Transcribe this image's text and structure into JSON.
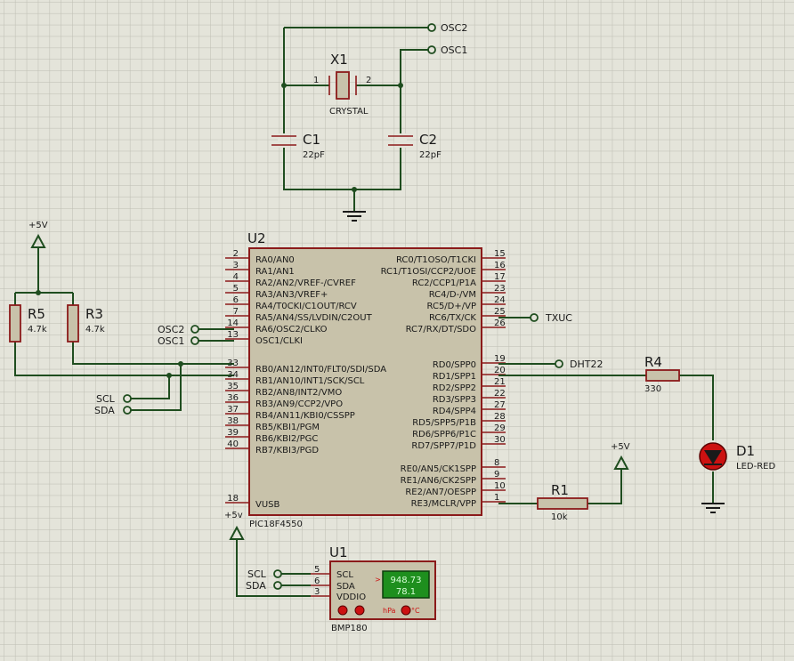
{
  "mcu": {
    "ref": "U2",
    "name": "PIC18F4550",
    "left_pins": [
      {
        "num": "2",
        "name": "RA0/AN0"
      },
      {
        "num": "3",
        "name": "RA1/AN1"
      },
      {
        "num": "4",
        "name": "RA2/AN2/VREF-/CVREF"
      },
      {
        "num": "5",
        "name": "RA3/AN3/VREF+"
      },
      {
        "num": "6",
        "name": "RA4/T0CKI/C1OUT/RCV"
      },
      {
        "num": "7",
        "name": "RA5/AN4/SS/LVDIN/C2OUT"
      },
      {
        "num": "14",
        "name": "RA6/OSC2/CLKO"
      },
      {
        "num": "13",
        "name": "OSC1/CLKI"
      },
      {
        "num": "33",
        "name": "RB0/AN12/INT0/FLT0/SDI/SDA"
      },
      {
        "num": "34",
        "name": "RB1/AN10/INT1/SCK/SCL"
      },
      {
        "num": "35",
        "name": "RB2/AN8/INT2/VMO"
      },
      {
        "num": "36",
        "name": "RB3/AN9/CCP2/VPO"
      },
      {
        "num": "37",
        "name": "RB4/AN11/KBI0/CSSPP"
      },
      {
        "num": "38",
        "name": "RB5/KBI1/PGM"
      },
      {
        "num": "39",
        "name": "RB6/KBI2/PGC"
      },
      {
        "num": "40",
        "name": "RB7/KBI3/PGD"
      },
      {
        "num": "18",
        "name": "VUSB"
      }
    ],
    "right_pins": [
      {
        "num": "15",
        "name": "RC0/T1OSO/T1CKI"
      },
      {
        "num": "16",
        "name": "RC1/T1OSI/CCP2/UOE"
      },
      {
        "num": "17",
        "name": "RC2/CCP1/P1A"
      },
      {
        "num": "23",
        "name": "RC4/D-/VM"
      },
      {
        "num": "24",
        "name": "RC5/D+/VP"
      },
      {
        "num": "25",
        "name": "RC6/TX/CK"
      },
      {
        "num": "26",
        "name": "RC7/RX/DT/SDO"
      },
      {
        "num": "19",
        "name": "RD0/SPP0"
      },
      {
        "num": "20",
        "name": "RD1/SPP1"
      },
      {
        "num": "21",
        "name": "RD2/SPP2"
      },
      {
        "num": "22",
        "name": "RD3/SPP3"
      },
      {
        "num": "27",
        "name": "RD4/SPP4"
      },
      {
        "num": "28",
        "name": "RD5/SPP5/P1B"
      },
      {
        "num": "29",
        "name": "RD6/SPP6/P1C"
      },
      {
        "num": "30",
        "name": "RD7/SPP7/P1D"
      },
      {
        "num": "8",
        "name": "RE0/AN5/CK1SPP"
      },
      {
        "num": "9",
        "name": "RE1/AN6/CK2SPP"
      },
      {
        "num": "10",
        "name": "RE2/AN7/OESPP"
      },
      {
        "num": "1",
        "name": "RE3/MCLR/VPP"
      }
    ],
    "vusb_supply": "+5v"
  },
  "crystal": {
    "ref": "X1",
    "name": "CRYSTAL",
    "pin1": "1",
    "pin2": "2"
  },
  "capacitors": [
    {
      "ref": "C1",
      "value": "22pF"
    },
    {
      "ref": "C2",
      "value": "22pF"
    }
  ],
  "resistors": {
    "r1": {
      "ref": "R1",
      "value": "10k"
    },
    "r3": {
      "ref": "R3",
      "value": "4.7k"
    },
    "r4": {
      "ref": "R4",
      "value": "330"
    },
    "r5": {
      "ref": "R5",
      "value": "4.7k"
    }
  },
  "led": {
    "ref": "D1",
    "name": "LED-RED",
    "color": "#cc1111"
  },
  "sensor": {
    "ref": "U1",
    "name": "BMP180",
    "pins": [
      {
        "num": "5",
        "name": "SCL"
      },
      {
        "num": "6",
        "name": "SDA"
      },
      {
        "num": "3",
        "name": "VDDIO"
      }
    ],
    "pressure": "948.73",
    "temperature": "78.1",
    "pressure_unit": "hPa",
    "temperature_unit": "°C",
    "display_color": "#1e8f1e"
  },
  "supplies": {
    "pullup": "+5V",
    "mclr": "+5V"
  },
  "terminals": {
    "osc2_top": "OSC2",
    "osc1_top": "OSC1",
    "osc2_mcu": "OSC2",
    "osc1_mcu": "OSC1",
    "scl_bus": "SCL",
    "sda_bus": "SDA",
    "scl_sensor": "SCL",
    "sda_sensor": "SDA",
    "txuc": "TXUC",
    "dht22": "DHT22"
  },
  "colors": {
    "wire": "#1f4d1f",
    "pin": "#8b1a1a",
    "body": "#c8c2aa",
    "background": "#e4e4da"
  }
}
